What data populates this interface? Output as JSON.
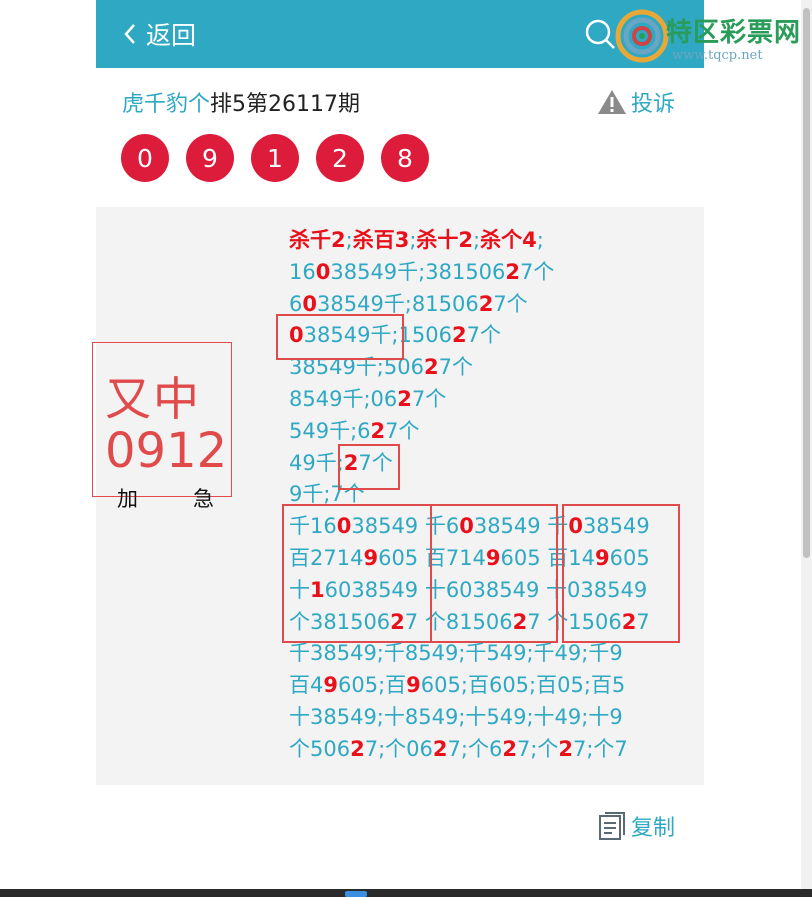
{
  "header": {
    "back_label": "返回"
  },
  "watermark": {
    "name": "特区彩票网",
    "url": "www.tqcp.net"
  },
  "title": {
    "author": "虎千豹个",
    "rest": "排5第26117期"
  },
  "complain_label": "投诉",
  "balls": [
    "0",
    "9",
    "1",
    "2",
    "8"
  ],
  "stamp": {
    "line1": "又中",
    "line2": "0912",
    "left_char": "加",
    "right_char": "急"
  },
  "content": {
    "header": [
      "杀千2",
      ";",
      "杀百3",
      ";",
      "杀十2",
      ";",
      "杀个4",
      ";"
    ],
    "lines": [
      [
        [
          "16",
          0
        ],
        [
          "0",
          1
        ],
        [
          "38549千;381506",
          0
        ],
        [
          "2",
          1
        ],
        [
          "7个",
          0
        ]
      ],
      [
        [
          "6",
          0
        ],
        [
          "0",
          1
        ],
        [
          "38549千;81506",
          0
        ],
        [
          "2",
          1
        ],
        [
          "7个",
          0
        ]
      ],
      [
        [
          "0",
          1
        ],
        [
          "38549千;1506",
          0
        ],
        [
          "2",
          1
        ],
        [
          "7个",
          0
        ]
      ],
      [
        [
          "38549千;506",
          0
        ],
        [
          "2",
          1
        ],
        [
          "7个",
          0
        ]
      ],
      [
        [
          "8549千;06",
          0
        ],
        [
          "2",
          1
        ],
        [
          "7个",
          0
        ]
      ],
      [
        [
          "549千;6",
          0
        ],
        [
          "2",
          1
        ],
        [
          "7个",
          0
        ]
      ],
      [
        [
          "49千;",
          0
        ],
        [
          "2",
          1
        ],
        [
          "7个",
          0
        ]
      ],
      [
        [
          "9千;7个",
          0
        ]
      ],
      [
        [
          "千16",
          0
        ],
        [
          "0",
          1
        ],
        [
          "38549 千6",
          0
        ],
        [
          "0",
          1
        ],
        [
          "38549 千",
          0
        ],
        [
          "0",
          1
        ],
        [
          "38549",
          0
        ]
      ],
      [
        [
          "百2714",
          0
        ],
        [
          "9",
          1
        ],
        [
          "605 百714",
          0
        ],
        [
          "9",
          1
        ],
        [
          "605 百14",
          0
        ],
        [
          "9",
          1
        ],
        [
          "605",
          0
        ]
      ],
      [
        [
          "十",
          0
        ],
        [
          "1",
          1
        ],
        [
          "6038549 十6038549 十038549",
          0
        ]
      ],
      [
        [
          "个381506",
          0
        ],
        [
          "2",
          1
        ],
        [
          "7 个81506",
          0
        ],
        [
          "2",
          1
        ],
        [
          "7 个1506",
          0
        ],
        [
          "2",
          1
        ],
        [
          "7",
          0
        ]
      ],
      [
        [
          "千38549;千8549;千549;千49;千9",
          0
        ]
      ],
      [
        [
          "百4",
          0
        ],
        [
          "9",
          1
        ],
        [
          "605;百",
          0
        ],
        [
          "9",
          1
        ],
        [
          "605;百605;百05;百5",
          0
        ]
      ],
      [
        [
          "十38549;十8549;十549;十49;十9",
          0
        ]
      ],
      [
        [
          "个506",
          0
        ],
        [
          "2",
          1
        ],
        [
          "7;个06",
          0
        ],
        [
          "2",
          1
        ],
        [
          "7;个6",
          0
        ],
        [
          "2",
          1
        ],
        [
          "7;个",
          0
        ],
        [
          "2",
          1
        ],
        [
          "7;个7",
          0
        ]
      ]
    ]
  },
  "copy_label": "复制",
  "colors": {
    "accent": "#2fa8c3",
    "ball": "#dc1c3a",
    "highlight": "#e8101a",
    "stamp": "#e04a4a"
  }
}
